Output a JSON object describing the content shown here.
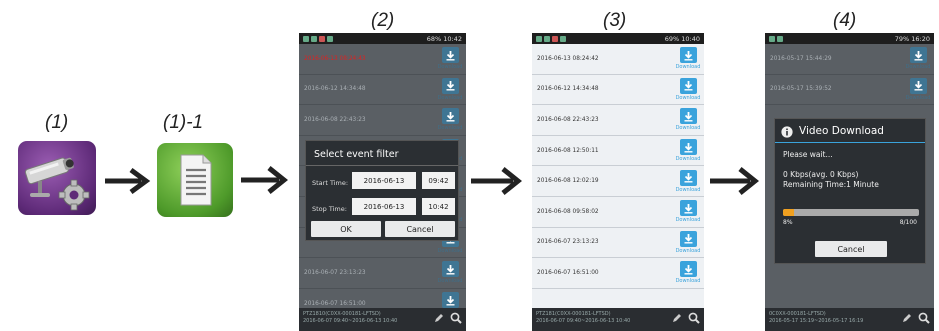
{
  "steps": [
    "(1)",
    "(1)-1",
    "(2)",
    "(3)",
    "(4)"
  ],
  "screen2": {
    "status_right": "68% 10:42",
    "rows": [
      "2016-06-13 08:24:43",
      "2016-06-12 14:34:48",
      "2016-06-08 22:43:23",
      "",
      "",
      "",
      "",
      "2016-06-07 23:13:23",
      "2016-06-07 16:51:00"
    ],
    "download_label": "Download",
    "dialog": {
      "title": "Select event filter",
      "start_label": "Start Time:",
      "start_date": "2016-06-13",
      "start_time": "09:42",
      "stop_label": "Stop Time:",
      "stop_date": "2016-06-13",
      "stop_time": "10:42",
      "ok": "OK",
      "cancel": "Cancel"
    },
    "footer_line1": "PTZ1810(C0XX-000181-LFTSD)",
    "footer_line2": "2016-06-07 09:40~2016-06-13 10:40"
  },
  "screen3": {
    "status_right": "69% 10:40",
    "rows": [
      "2016-06-13 08:24:42",
      "2016-06-12 14:34:48",
      "2016-06-08 22:43:23",
      "2016-06-08 12:50:11",
      "2016-06-08 12:02:19",
      "2016-06-08 09:58:02",
      "2016-06-07 23:13:23",
      "2016-06-07 16:51:00"
    ],
    "download_label": "Download",
    "footer_line1": "PTZ181(C0XX-000181-LFTSD)",
    "footer_line2": "2016-06-07 09:40~2016-06-13 10:40"
  },
  "screen4": {
    "status_right": "79% 16:20",
    "rows": [
      "2016-05-17 15:44:29",
      "2016-05-17 15:39:52"
    ],
    "download_label": "Download",
    "dialog": {
      "title": "Video Download",
      "wait": "Please wait...",
      "rate": "0 Kbps(avg. 0 Kbps)",
      "remaining": "Remaining Time:1 Minute",
      "percent": "8%",
      "count": "8/100",
      "progress": 0.08,
      "cancel": "Cancel"
    },
    "footer_line1": "0C0XX-000181-LFTSD)",
    "footer_line2": "2016-05-17 15:19~2016-05-17 16:19"
  },
  "colors": {
    "accent": "#3aa3dc",
    "progress": "#f0a020",
    "dialog": "#2b2f33"
  }
}
